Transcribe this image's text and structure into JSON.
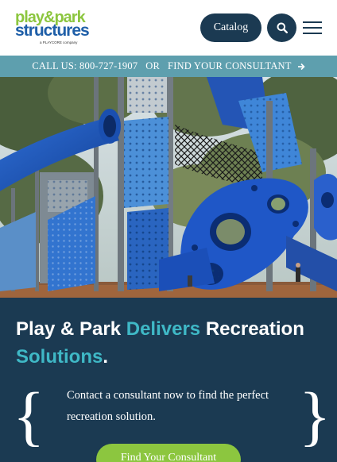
{
  "header": {
    "logo": {
      "line1": "play&park",
      "line2": "structures",
      "tagline": "a PLAYCORE company"
    },
    "catalog_label": "Catalog",
    "search_icon": "search-icon",
    "menu_icon": "hamburger-menu-icon"
  },
  "contact_bar": {
    "call_text": "CALL US: 800-727-1907",
    "or_text": "OR",
    "consultant_text": "FIND YOUR CONSULTANT",
    "arrow_icon": "arrow-right-icon"
  },
  "hero": {
    "image_description_icon": "playground-hero-image"
  },
  "panel": {
    "headline_part1": "Play & Park ",
    "headline_accent1": "Delivers",
    "headline_part2": " Recreation ",
    "headline_accent2": "Solutions",
    "headline_end": ".",
    "contact_line": "Contact a consultant now to find the perfect recreation solution.",
    "brace_left": "{",
    "brace_right": "}",
    "cta_label": "Find Your Consultant"
  },
  "colors": {
    "navy": "#1b3a52",
    "teal_bar": "#5e9fae",
    "accent_teal": "#3fb8c6",
    "green": "#8cc63f",
    "logo_blue": "#1f5fa8"
  }
}
